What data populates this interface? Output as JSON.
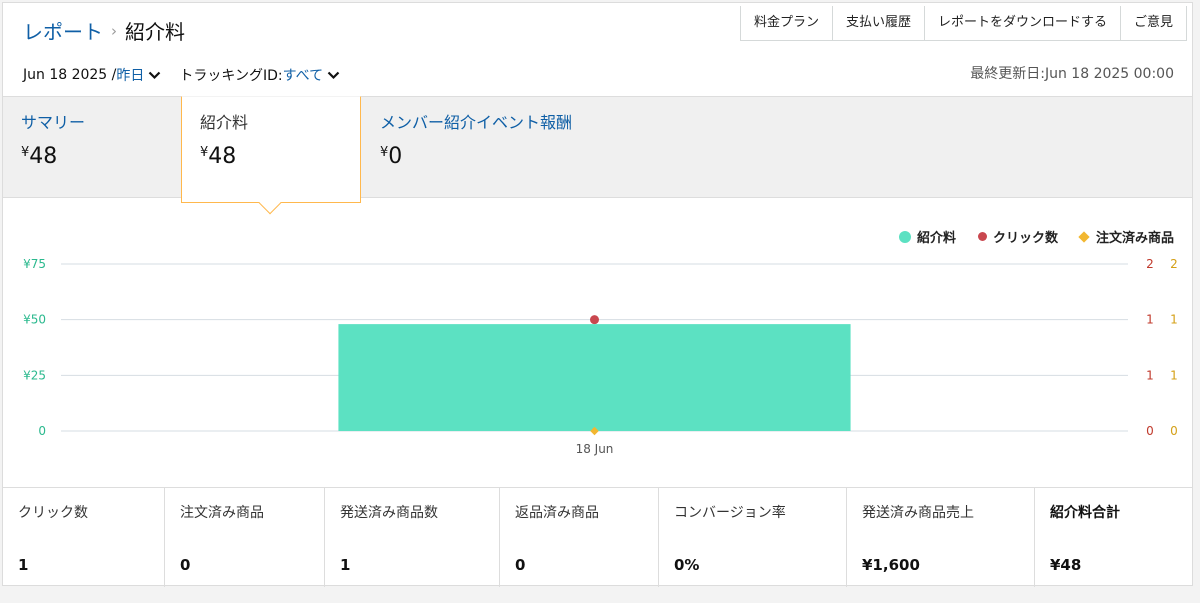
{
  "breadcrumb": {
    "parent": "レポート",
    "separator": "›",
    "current": "紹介料"
  },
  "top_buttons": [
    "料金プラン",
    "支払い履歴",
    "レポートをダウンロードする",
    "ご意見"
  ],
  "filters": {
    "date_prefix": "Jun 18 2025 /",
    "date_link": "昨日",
    "tracking_label": "トラッキングID:",
    "tracking_value": "すべて"
  },
  "last_updated": "最終更新日:Jun 18 2025 00:00",
  "tiles": [
    {
      "label": "サマリー",
      "currency": "¥",
      "amount": "48"
    },
    {
      "label": "紹介料",
      "currency": "¥",
      "amount": "48"
    },
    {
      "label": "メンバー紹介イベント報酬",
      "currency": "¥",
      "amount": "0"
    }
  ],
  "legend": [
    "紹介料",
    "クリック数",
    "注文済み商品"
  ],
  "colors": {
    "fee": "#5ce1c2",
    "clicks": "#c9474f",
    "orders": "#f2b731",
    "link": "#0f5fa6",
    "highlight": "#ffb84d"
  },
  "chart_data": {
    "type": "bar",
    "categories": [
      "18 Jun"
    ],
    "series": [
      {
        "name": "紹介料",
        "kind": "bar",
        "axis": "left",
        "values": [
          48
        ]
      },
      {
        "name": "クリック数",
        "kind": "point",
        "axis": "right1",
        "values": [
          1
        ]
      },
      {
        "name": "注文済み商品",
        "kind": "point",
        "axis": "right2",
        "values": [
          0
        ]
      }
    ],
    "left_axis": {
      "ticks": [
        "0",
        "¥25",
        "¥50",
        "¥75"
      ],
      "range": [
        0,
        75
      ]
    },
    "right_axis_1": {
      "ticks": [
        "0",
        "1",
        "1",
        "2"
      ],
      "range": [
        0,
        1.5
      ]
    },
    "right_axis_2": {
      "ticks": [
        "0",
        "1",
        "1",
        "2"
      ],
      "range": [
        0,
        1.5
      ]
    },
    "grid": true
  },
  "metrics": [
    {
      "label": "クリック数",
      "value": "1"
    },
    {
      "label": "注文済み商品",
      "value": "0"
    },
    {
      "label": "発送済み商品数",
      "value": "1"
    },
    {
      "label": "返品済み商品",
      "value": "0"
    },
    {
      "label": "コンバージョン率",
      "value": "0%"
    },
    {
      "label": "発送済み商品売上",
      "value": "¥1,600"
    },
    {
      "label": "紹介料合計",
      "value": "¥48"
    }
  ]
}
